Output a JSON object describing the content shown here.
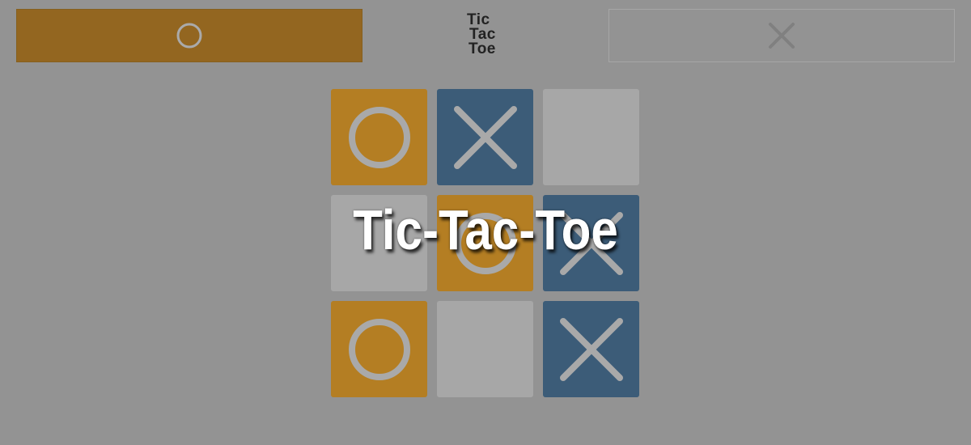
{
  "header": {
    "logo_lines": [
      "Tic",
      "Tac",
      "Toe"
    ],
    "player_o": {
      "mark": "O",
      "icon": "o-mark-icon",
      "active": true
    },
    "player_x": {
      "mark": "X",
      "icon": "x-mark-icon",
      "active": false
    }
  },
  "board": {
    "cells": [
      "O",
      "X",
      "",
      "",
      "O",
      "X",
      "O",
      "",
      "X"
    ]
  },
  "overlay": {
    "title": "Tic-Tac-Toe"
  },
  "colors": {
    "o_cell": "#b47e23",
    "x_cell": "#3c5c78",
    "empty_cell": "#a7a7a7",
    "mark_stroke": "#a9a9a9",
    "active_bar": "#936620",
    "background": "#939393"
  }
}
